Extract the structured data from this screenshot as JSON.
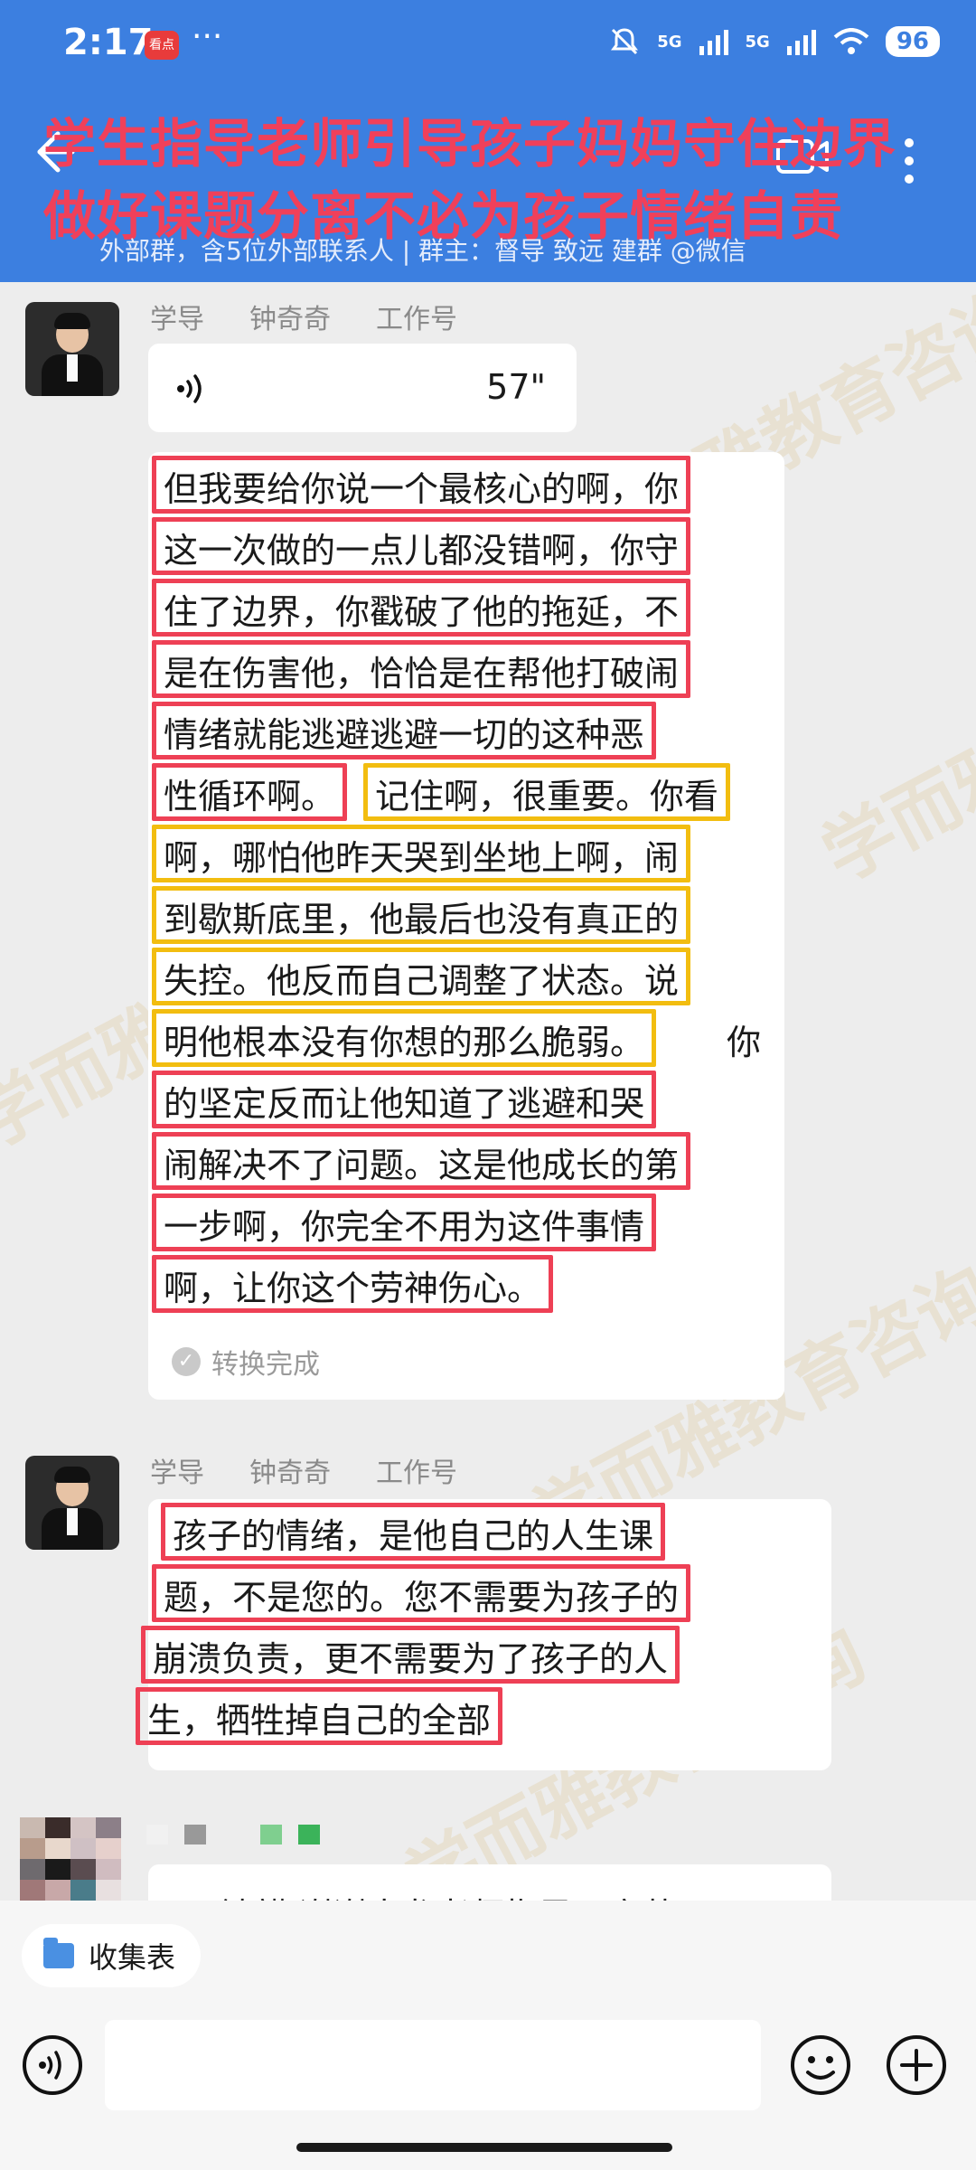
{
  "status_bar": {
    "time": "2:17",
    "app_badge": "看点",
    "dots": "···",
    "signal_1": "5G",
    "signal_2": "5G",
    "battery": "96"
  },
  "header": {
    "overlay_title_1": "学生指导老师引导孩子妈妈守住边界",
    "overlay_title_2": "做好课题分离不必为孩子情绪自责",
    "group_info": "外部群，含5位外部联系人 | 群主：督导  致远     建群 @微信"
  },
  "messages": [
    {
      "sender_role": "学导",
      "sender_name": "钟奇奇",
      "sender_tag": "工作号",
      "voice_duration": "57\"",
      "transcript_lines": [
        "但我要给你说一个最核心的啊，你",
        "这一次做的一点儿都没错啊，你守",
        "住了边界，你戳破了他的拖延，不",
        "是在伤害他，恰恰是在帮他打破闹",
        "情绪就能逃避逃避一切的这种恶",
        "性循环啊。",
        "记住啊，很重要。你看",
        "啊，哪怕他昨天哭到坐地上啊，闹",
        "到歇斯底里，他最后也没有真正的",
        "失控。他反而自己调整了状态。说",
        "明他根本没有你想的那么脆弱。",
        "你",
        "的坚定反而让他知道了逃避和哭",
        "闹解决不了问题。这是他成长的第",
        "一步啊，你完全不用为这件事情",
        "啊，让你这个劳神伤心。"
      ],
      "transcript_status": "转换完成"
    },
    {
      "sender_role": "学导",
      "sender_name": "钟奇奇",
      "sender_tag": "工作号",
      "text_lines": [
        "孩子的情绪，是他自己的人生课",
        "题，不是您的。您不需要为孩子的",
        "崩溃负责，更不需要为了孩子的人",
        "生，牺牲掉自己的全部"
      ]
    },
    {
      "text_partial": "@钟麒 谢谢大龙老师指导，齐英"
    }
  ],
  "bottom": {
    "chip_label": "收集表"
  },
  "colors": {
    "header_bg": "#3c7fe0",
    "highlight_red": "#ee4055",
    "highlight_yellow": "#f2bd10",
    "overlay_text": "#f0405a"
  }
}
